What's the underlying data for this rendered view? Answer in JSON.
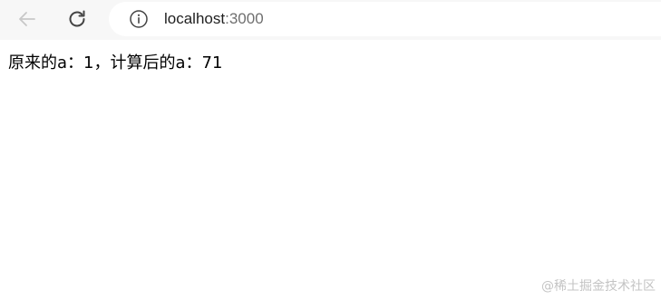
{
  "browser": {
    "url_host": "localhost",
    "url_port": ":3000",
    "icons": {
      "back": "arrow-left-icon",
      "reload": "reload-icon",
      "site_info": "info-icon"
    },
    "colors": {
      "toolbar_bg": "#f7f7f7",
      "disabled_icon": "#c8c8c8",
      "active_icon": "#444444"
    }
  },
  "page": {
    "result_text": "原来的a：1，计算后的a：71"
  },
  "watermark": "@稀土掘金技术社区"
}
